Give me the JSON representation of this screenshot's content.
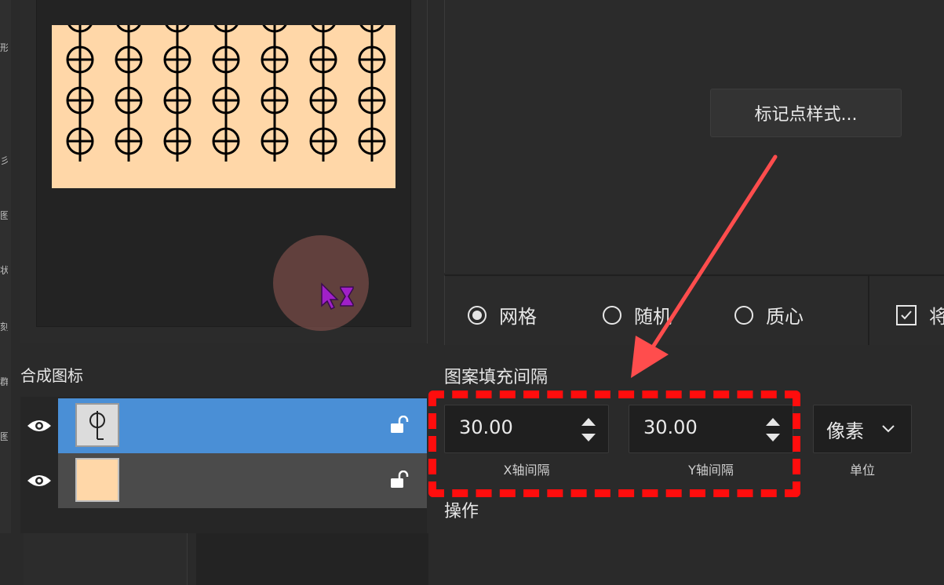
{
  "preview": {
    "pattern_color": "#ffd7a8",
    "glyph_color": "#000000",
    "pattern_rows": 3,
    "pattern_cols": 7
  },
  "marker_style": {
    "label": "标记点样式..."
  },
  "distribution": {
    "options": [
      {
        "label": "网格",
        "selected": true
      },
      {
        "label": "随机",
        "selected": false
      },
      {
        "label": "质心",
        "selected": false
      }
    ],
    "checkbox": {
      "label": "将",
      "checked": true
    }
  },
  "composite_icons": {
    "title": "合成图标",
    "layers": [
      {
        "selected": true,
        "thumb_glyph": "ℓ",
        "background": "#4a8fd6"
      },
      {
        "selected": false,
        "thumb_color": "#ffd7a8",
        "background": "#4b4b4b"
      }
    ]
  },
  "spacing": {
    "title": "图案填充间隔",
    "x": {
      "value": "30.00",
      "label": "X轴间隔"
    },
    "y": {
      "value": "30.00",
      "label": "Y轴间隔"
    },
    "unit": {
      "value": "像素",
      "label": "单位"
    }
  },
  "operation": {
    "title": "操作"
  },
  "left_strip_chars": [
    "形",
    "彡",
    "图",
    "状",
    "刻",
    "群",
    "图"
  ],
  "colors": {
    "highlight_box": "#ff0d0d",
    "arrow": "#ff4d4d",
    "accent_blue": "#4a8fd6"
  }
}
